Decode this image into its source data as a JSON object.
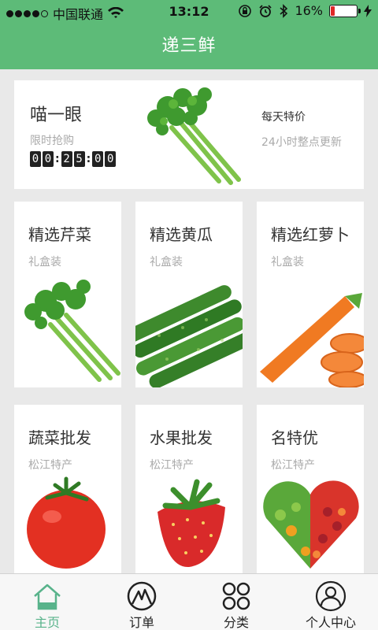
{
  "status_bar": {
    "carrier": "中国联通",
    "time": "13:12",
    "battery": "16%"
  },
  "header": {
    "title": "递三鲜"
  },
  "promo": {
    "title": "喵一眼",
    "subtitle": "限时抢购",
    "timer": [
      "0",
      "0",
      "2",
      "5",
      "0",
      "0"
    ],
    "right_title": "每天特价",
    "right_subtitle": "24小时整点更新"
  },
  "featured": [
    {
      "title": "精选芹菜",
      "subtitle": "礼盒装",
      "image": "celery-image"
    },
    {
      "title": "精选黄瓜",
      "subtitle": "礼盒装",
      "image": "cucumber-image"
    },
    {
      "title": "精选红萝卜",
      "subtitle": "礼盒装",
      "image": "carrot-image"
    }
  ],
  "wholesale": [
    {
      "title": "蔬菜批发",
      "subtitle": "松江特产",
      "image": "tomato-image"
    },
    {
      "title": "水果批发",
      "subtitle": "松江特产",
      "image": "strawberry-image"
    },
    {
      "title": "名特优",
      "subtitle": "松江特产",
      "image": "heart-produce-image"
    }
  ],
  "tabbar": {
    "items": [
      {
        "label": "主页",
        "icon": "home-icon",
        "active": true
      },
      {
        "label": "订单",
        "icon": "orders-icon",
        "active": false
      },
      {
        "label": "分类",
        "icon": "category-icon",
        "active": false
      },
      {
        "label": "个人中心",
        "icon": "profile-icon",
        "active": false
      }
    ]
  },
  "colors": {
    "header_green": "#5dbb78",
    "active_tab": "#58b38b",
    "battery_red": "#e02828"
  }
}
